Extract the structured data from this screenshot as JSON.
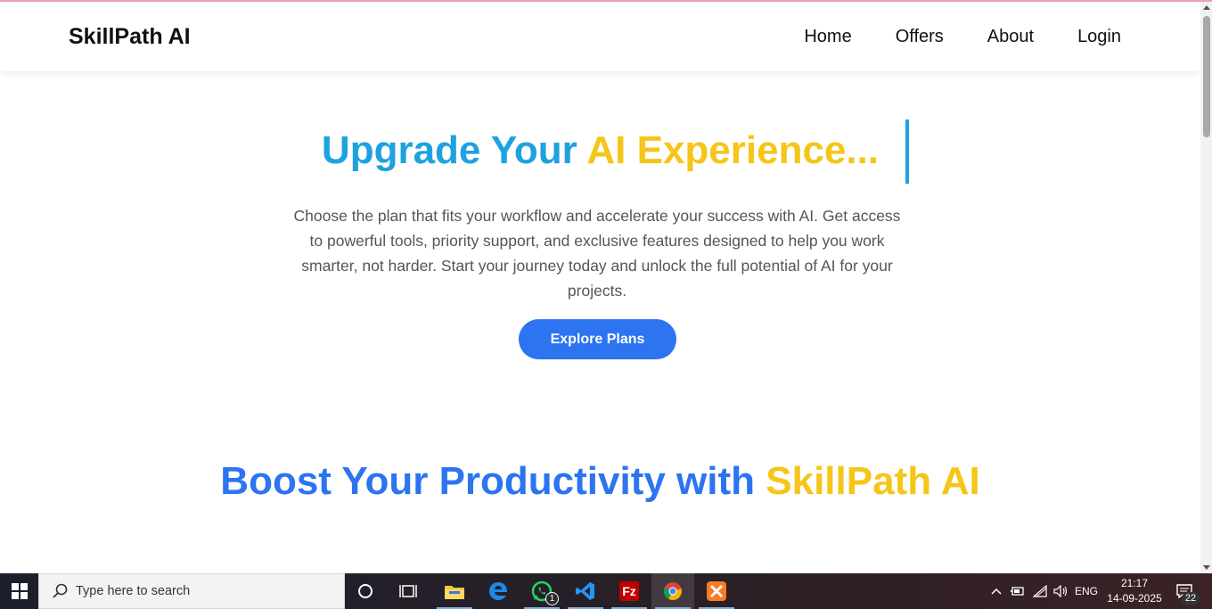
{
  "navbar": {
    "brand": "SkillPath AI",
    "links": [
      "Home",
      "Offers",
      "About",
      "Login"
    ]
  },
  "hero": {
    "title_part1": "Upgrade Your ",
    "title_part2": "AI Experience...",
    "description": "Choose the plan that fits your workflow and accelerate your success with AI. Get access to powerful tools, priority support, and exclusive features designed to help you work smarter, not harder. Start your journey today and unlock the full potential of AI for your projects.",
    "button_label": "Explore Plans"
  },
  "section2": {
    "title_part1": "Boost Your Productivity with ",
    "title_part2": "SkillPath AI"
  },
  "colors": {
    "hero_blue": "#1ea2df",
    "accent_yellow": "#f5c518",
    "button_blue": "#2c74f0"
  },
  "taskbar": {
    "search_placeholder": "Type here to search",
    "whatsapp_badge": "1",
    "language": "ENG",
    "time": "21:17",
    "date": "14-09-2025",
    "notification_count": "22",
    "apps": [
      "cortana-icon",
      "task-view-icon",
      "file-explorer-icon",
      "edge-icon",
      "whatsapp-icon",
      "vscode-icon",
      "filezilla-icon",
      "chrome-icon",
      "xampp-icon"
    ]
  }
}
